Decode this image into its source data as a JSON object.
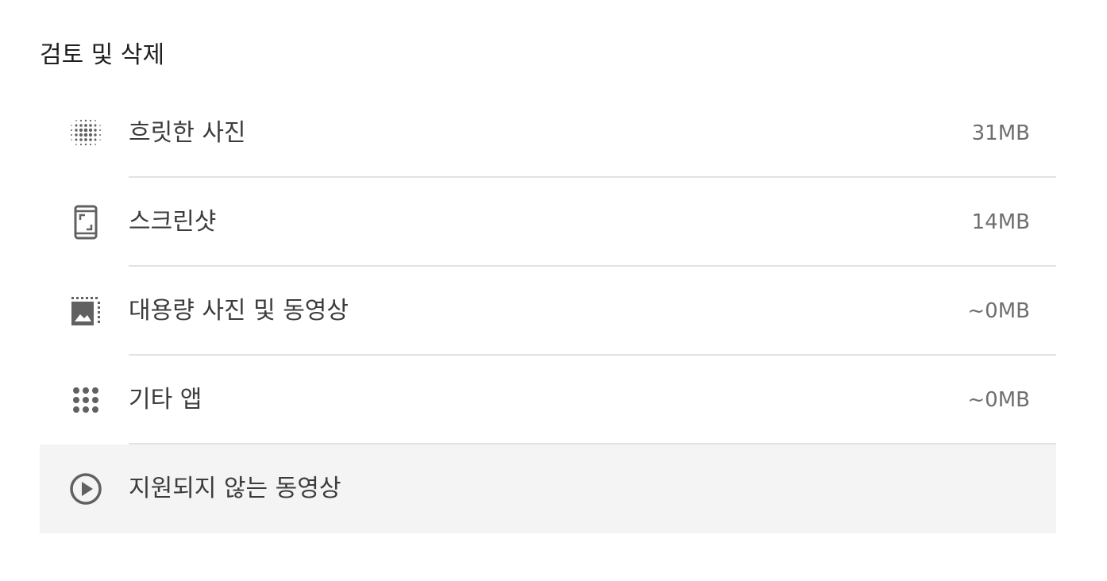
{
  "section": {
    "title": "검토 및 삭제"
  },
  "items": [
    {
      "icon": "blurry-photo-icon",
      "label": "흐릿한 사진",
      "size": "31MB"
    },
    {
      "icon": "screenshot-icon",
      "label": "스크린샷",
      "size": "14MB"
    },
    {
      "icon": "large-media-icon",
      "label": "대용량 사진 및 동영상",
      "size": "~0MB"
    },
    {
      "icon": "apps-grid-icon",
      "label": "기타 앱",
      "size": "~0MB"
    },
    {
      "icon": "play-circle-icon",
      "label": "지원되지 않는 동영상",
      "size": ""
    }
  ],
  "colors": {
    "icon": "#616161",
    "text": "#3c3c3c",
    "size_text": "#6f6f6f",
    "divider": "#e2e2e2",
    "highlight_row": "#f4f4f4"
  }
}
